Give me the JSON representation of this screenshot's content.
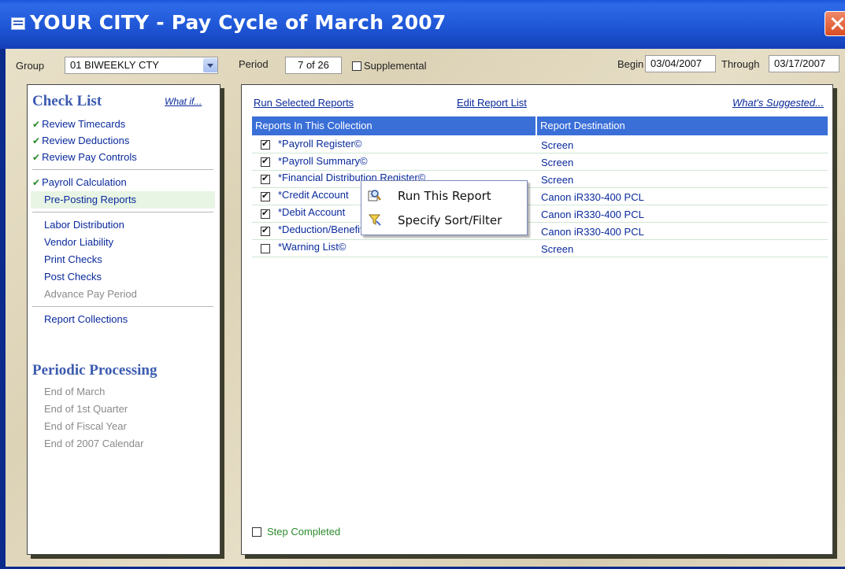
{
  "window": {
    "title": "YOUR CITY - Pay Cycle of March 2007"
  },
  "toolbar": {
    "group_label": "Group",
    "group_value": "01 BIWEEKLY CTY",
    "period_label": "Period",
    "period_value": "7 of 26",
    "supplemental_label": "Supplemental",
    "begin_label": "Begin",
    "begin_value": "03/04/2007",
    "through_label": "Through",
    "through_value": "03/17/2007"
  },
  "sidebar": {
    "checklist_title": "Check List",
    "what_if_link": "What if...",
    "items": [
      {
        "label": "Review Timecards",
        "done": true
      },
      {
        "label": "Review Deductions",
        "done": true
      },
      {
        "label": "Review Pay Controls",
        "done": true
      },
      {
        "label": "Payroll Calculation",
        "done": true
      },
      {
        "label": "Pre-Posting Reports",
        "done": false
      },
      {
        "label": "Labor Distribution",
        "done": false
      },
      {
        "label": "Vendor Liability",
        "done": false
      },
      {
        "label": "Print Checks",
        "done": false
      },
      {
        "label": "Post Checks",
        "done": false
      },
      {
        "label": "Advance Pay Period",
        "done": false
      },
      {
        "label": "Report Collections",
        "done": false
      }
    ],
    "periodic_title": "Periodic Processing",
    "periodic_items": [
      "End of March",
      "End of 1st Quarter",
      "End of Fiscal Year",
      "End of 2007 Calendar"
    ]
  },
  "main": {
    "run_selected": "Run Selected Reports",
    "edit_list": "Edit Report List",
    "whats_suggested": "What's Suggested...",
    "col_reports": "Reports In This Collection",
    "col_destination": "Report Destination",
    "reports": [
      {
        "name": "*Payroll Register©",
        "destination": "Screen",
        "checked": true
      },
      {
        "name": "*Payroll Summary©",
        "destination": "Screen",
        "checked": true
      },
      {
        "name": "*Financial Distribution Register©",
        "destination": "Screen",
        "checked": true
      },
      {
        "name": "*Credit Account",
        "destination": "Canon iR330-400 PCL",
        "checked": true
      },
      {
        "name": "*Debit Account",
        "destination": "Canon iR330-400 PCL",
        "checked": true
      },
      {
        "name": "*Deduction/Benefit Register",
        "destination": "Canon iR330-400 PCL",
        "checked": true
      },
      {
        "name": "*Warning List©",
        "destination": "Screen",
        "checked": false
      }
    ],
    "step_completed": "Step Completed"
  },
  "context_menu": {
    "run_report": "Run This Report",
    "sort_filter": "Specify Sort/Filter"
  }
}
